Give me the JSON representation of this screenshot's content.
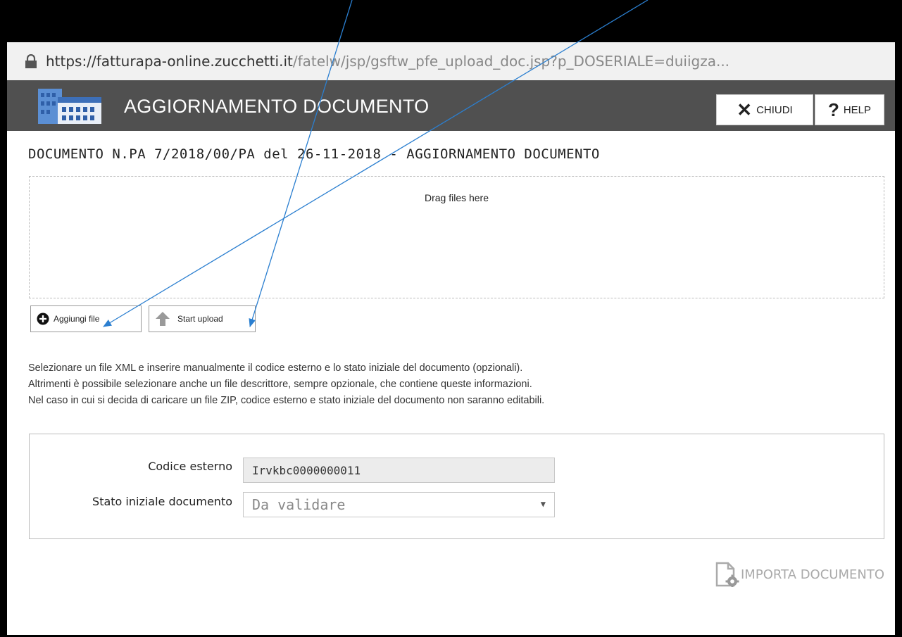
{
  "browser": {
    "url_domain": "https://fatturapa-online.zucchetti.it",
    "url_path": "/fatelw/jsp/gsftw_pfe_upload_doc.jsp?p_DOSERIALE=duiigza..."
  },
  "titlebar": {
    "title": "AGGIORNAMENTO DOCUMENTO",
    "close_label": "CHIUDI",
    "help_label": "HELP"
  },
  "page": {
    "heading": "DOCUMENTO N.PA 7/2018/00/PA del 26-11-2018 - AGGIORNAMENTO DOCUMENTO"
  },
  "upload": {
    "drop_text": "Drag files here",
    "add_file_label": "Aggiungi file",
    "start_upload_label": "Start upload"
  },
  "info": {
    "lines": [
      "Selezionare un file XML e inserire manualmente il codice esterno e lo stato iniziale del documento (opzionali).",
      "Altrimenti è possibile selezionare anche un file descrittore, sempre opzionale, che contiene queste informazioni.",
      "Nel caso in cui si decida di caricare un file ZIP, codice esterno e stato iniziale del documento non saranno editabili."
    ]
  },
  "form": {
    "codice_label": "Codice esterno",
    "codice_value": "Irvkbc0000000011",
    "stato_label": "Stato iniziale documento",
    "stato_value": "Da validare"
  },
  "actions": {
    "import_label": "IMPORTA DOCUMENTO"
  },
  "icons": [
    "lock-icon",
    "building-logo-icon",
    "close-icon",
    "help-icon",
    "add-circle-icon",
    "upload-arrow-icon",
    "dropdown-arrow-icon",
    "document-gear-icon"
  ],
  "colors": {
    "titlebar_bg": "#505050",
    "annotation_arrow": "#2b7fd0"
  }
}
